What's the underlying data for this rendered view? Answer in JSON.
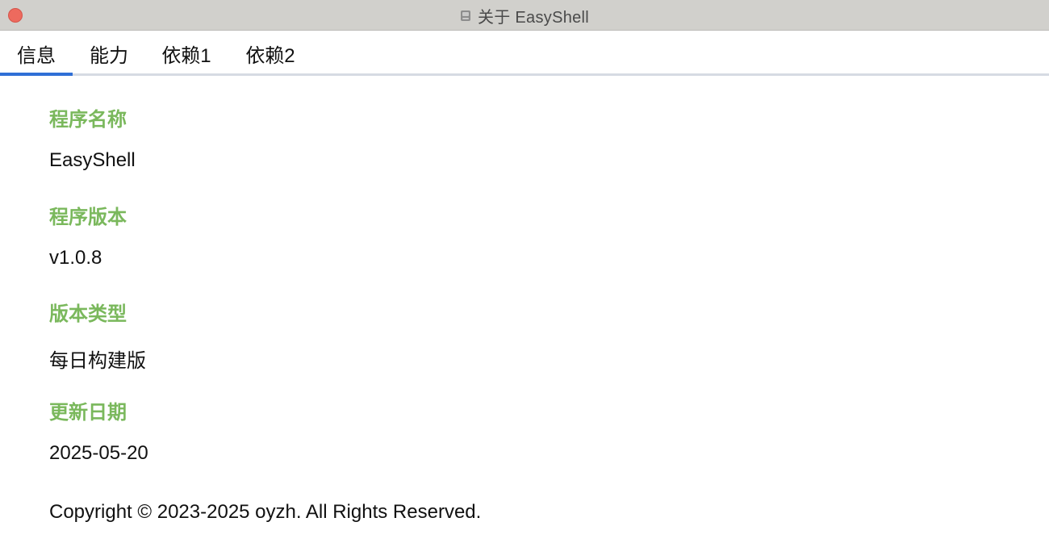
{
  "window": {
    "title": "关于 EasyShell",
    "app_icon": "app-icon"
  },
  "tabs": [
    {
      "label": "信息",
      "active": true
    },
    {
      "label": "能力",
      "active": false
    },
    {
      "label": "依赖1",
      "active": false
    },
    {
      "label": "依赖2",
      "active": false
    }
  ],
  "info": {
    "name_label": "程序名称",
    "name_value": "EasyShell",
    "version_label": "程序版本",
    "version_value": "v1.0.8",
    "type_label": "版本类型",
    "type_value": "每日构建版",
    "date_label": "更新日期",
    "date_value": "2025-05-20",
    "copyright": "Copyright © 2023-2025 oyzh. All Rights Reserved."
  },
  "colors": {
    "accent": "#2f6fd6",
    "label_green": "#7ab85c",
    "close_red": "#ed6a5e",
    "titlebar": "#d1d0cc"
  }
}
